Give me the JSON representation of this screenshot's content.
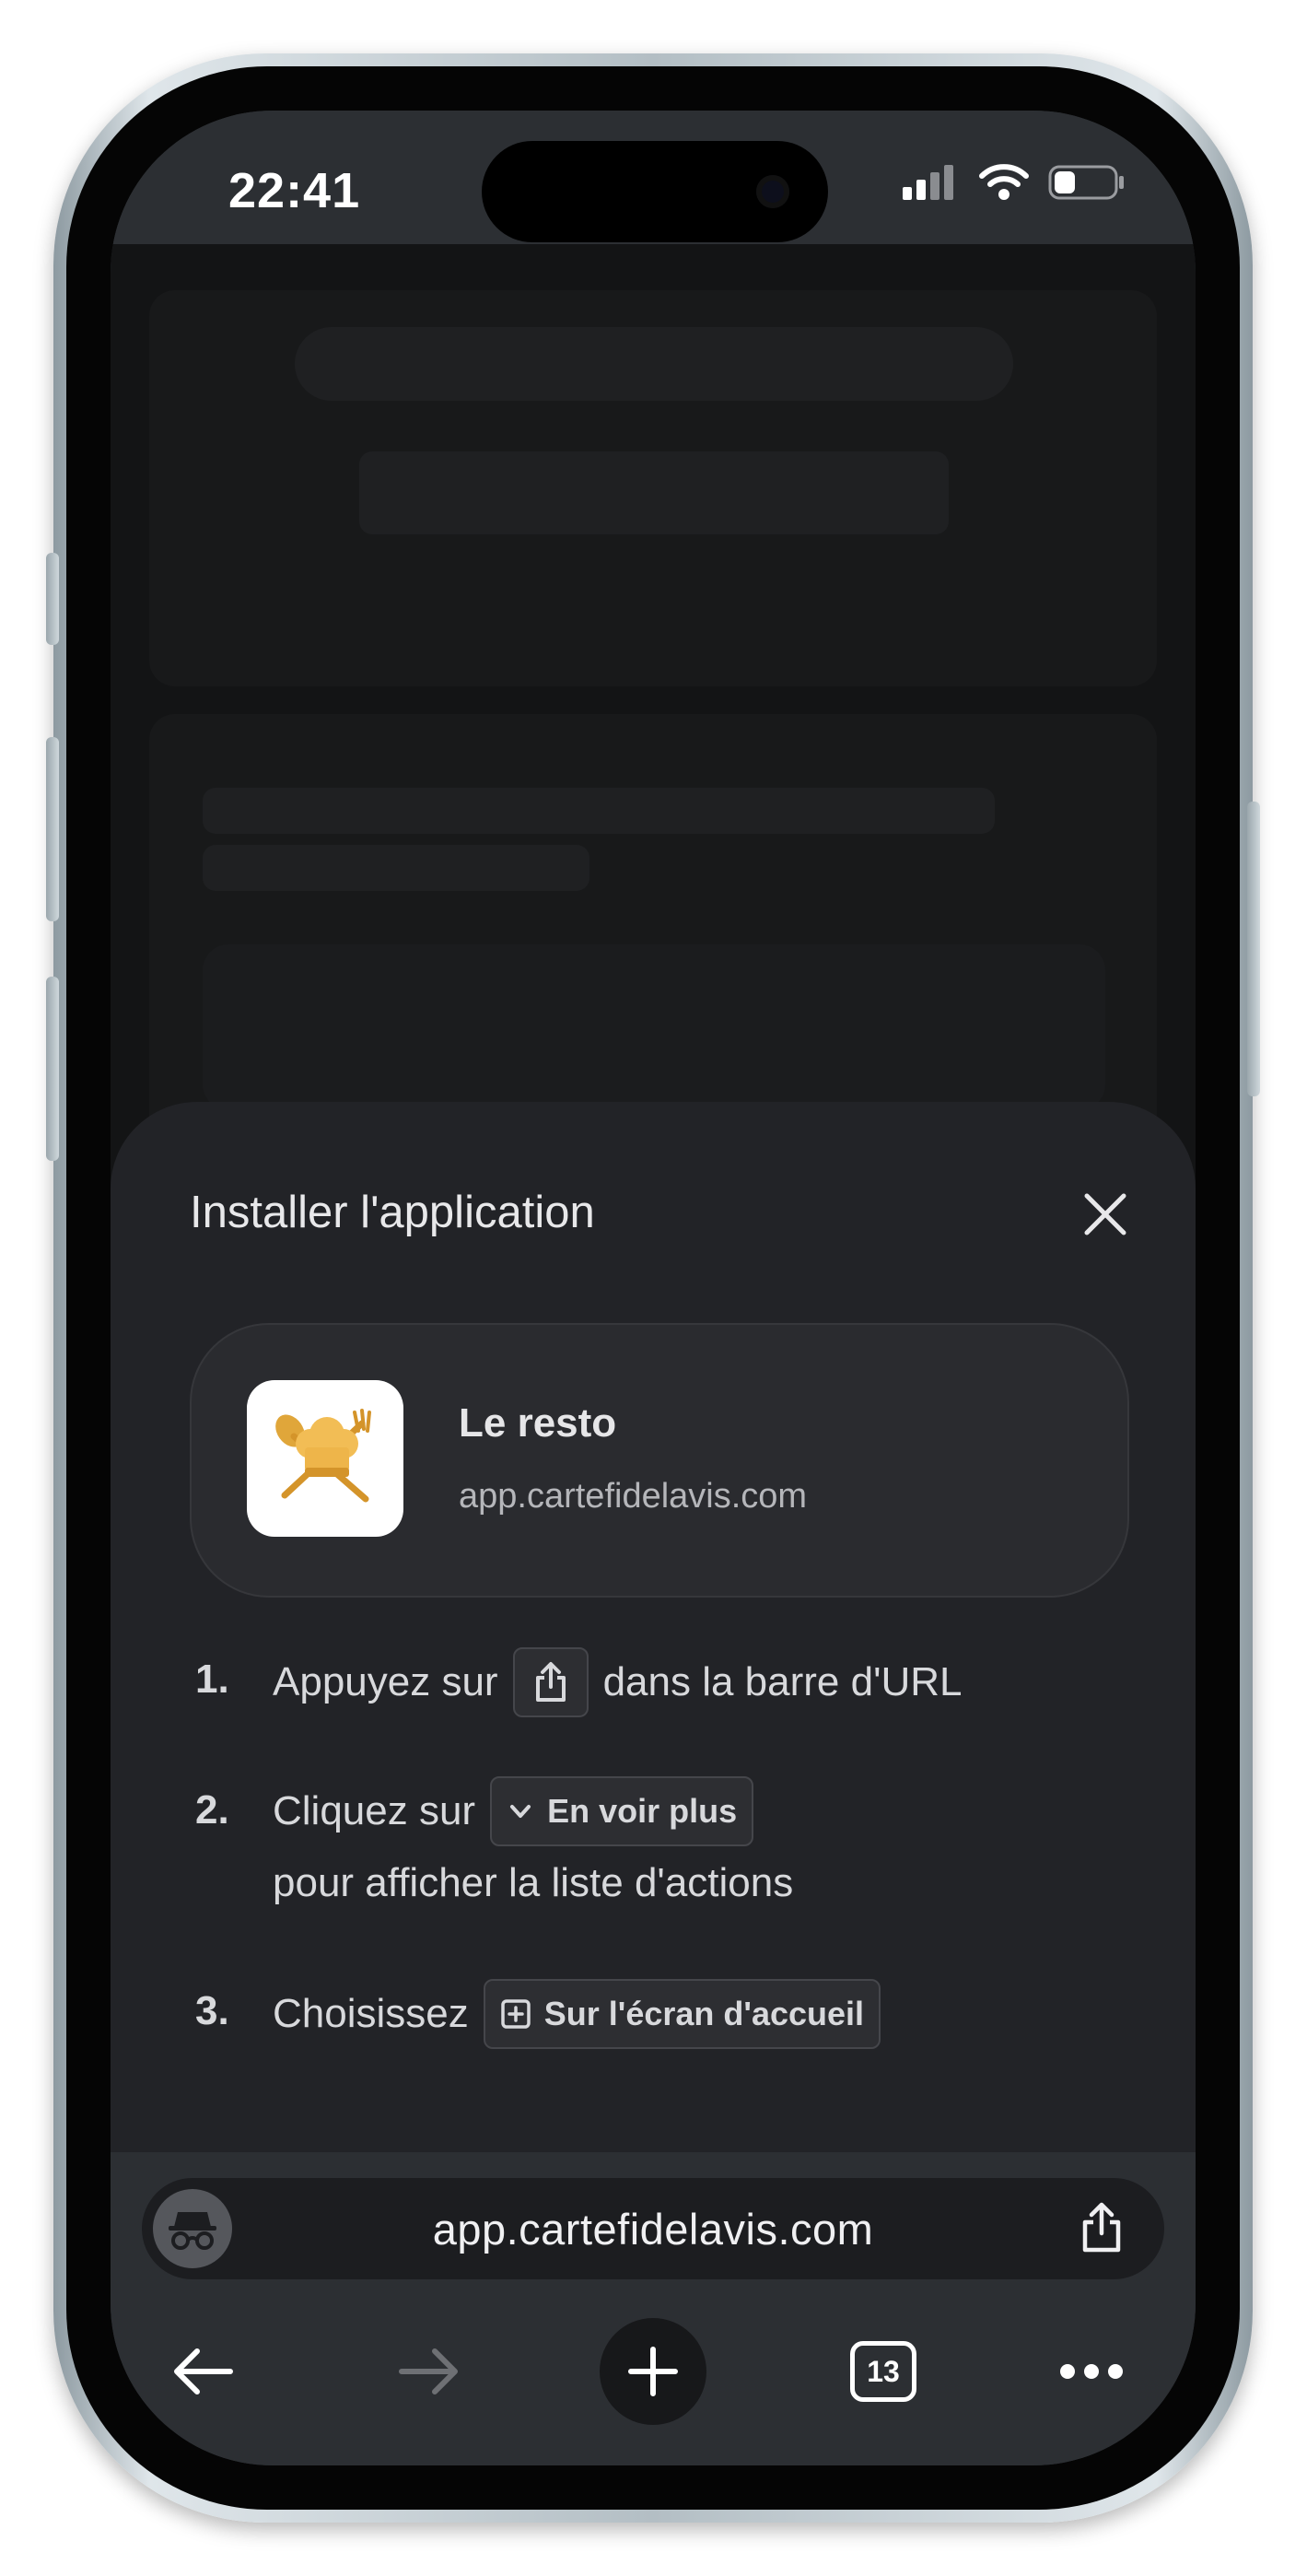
{
  "status_bar": {
    "time": "22:41",
    "icons": [
      "cellular-signal-icon",
      "wifi-icon",
      "battery-icon"
    ]
  },
  "sheet": {
    "title": "Installer l'application",
    "app": {
      "name": "Le resto",
      "url": "app.cartefidelavis.com",
      "icon": "chef-hat-utensils-icon"
    },
    "steps": [
      {
        "number": "1.",
        "text_before": "Appuyez sur",
        "chip_icon": "share-icon",
        "text_after": "dans la barre d'URL"
      },
      {
        "number": "2.",
        "text_before": "Cliquez sur",
        "chip_icon": "chevron-down-icon",
        "chip_label": "En voir plus",
        "line2": "pour afficher la liste d'actions"
      },
      {
        "number": "3.",
        "text_before": "Choisissez",
        "chip_icon": "add-square-icon",
        "chip_label": "Sur l'écran d'accueil"
      }
    ]
  },
  "browser": {
    "url": "app.cartefidelavis.com",
    "tab_count": "13"
  },
  "colors": {
    "sheet_bg": "#222327",
    "bars_bg": "#2c2f33",
    "text_primary": "#e8e8ea",
    "icon_accent": "#e0a63a"
  }
}
